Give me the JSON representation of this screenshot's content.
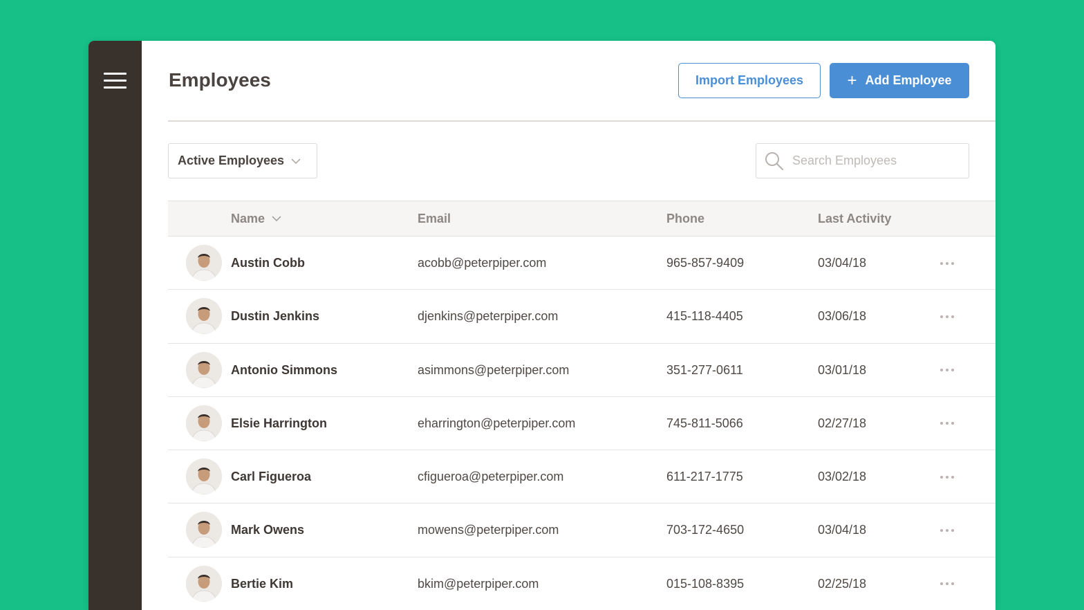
{
  "header": {
    "title": "Employees",
    "import_label": "Import Employees",
    "add_label": "Add Employee",
    "add_icon": "+"
  },
  "filters": {
    "status_selected": "Active Employees",
    "search_placeholder": "Search Employees"
  },
  "table": {
    "columns": {
      "name": "Name",
      "email": "Email",
      "phone": "Phone",
      "last_activity": "Last Activity"
    },
    "rows": [
      {
        "name": "Austin Cobb",
        "email": "acobb@peterpiper.com",
        "phone": "965-857-9409",
        "last_activity": "03/04/18"
      },
      {
        "name": "Dustin Jenkins",
        "email": "djenkins@peterpiper.com",
        "phone": "415-118-4405",
        "last_activity": "03/06/18"
      },
      {
        "name": "Antonio Simmons",
        "email": "asimmons@peterpiper.com",
        "phone": "351-277-0611",
        "last_activity": "03/01/18"
      },
      {
        "name": "Elsie Harrington",
        "email": "eharrington@peterpiper.com",
        "phone": "745-811-5066",
        "last_activity": "02/27/18"
      },
      {
        "name": "Carl Figueroa",
        "email": "cfigueroa@peterpiper.com",
        "phone": "611-217-1775",
        "last_activity": "03/02/18"
      },
      {
        "name": "Mark Owens",
        "email": "mowens@peterpiper.com",
        "phone": "703-172-4650",
        "last_activity": "03/04/18"
      },
      {
        "name": "Bertie Kim",
        "email": "bkim@peterpiper.com",
        "phone": "015-108-8395",
        "last_activity": "02/25/18"
      }
    ]
  },
  "colors": {
    "background": "#16c087",
    "sidebar": "#38312c",
    "accent": "#4a8fd6"
  },
  "icons": {
    "menu": "hamburger-menu-icon",
    "search": "search-icon",
    "sort": "chevron-down-icon",
    "row_actions": "more-options-icon"
  }
}
